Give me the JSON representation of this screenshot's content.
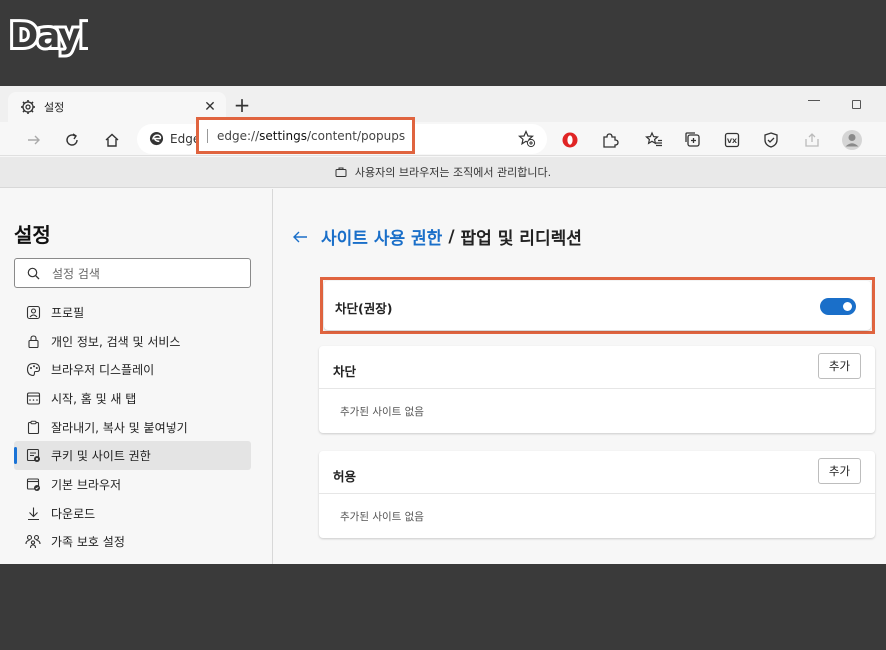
{
  "logo": {
    "text": "DayB"
  },
  "tab": {
    "title": "설정",
    "close": "✕",
    "new_tab": "+"
  },
  "address": {
    "site_label": "Edge",
    "url_prefix": "edge://",
    "url_highlight": "settings",
    "url_suffix": "/content/popups"
  },
  "managed_notice": "사용자의 브라우저는 조직에서 관리합니다.",
  "sidebar": {
    "title": "설정",
    "search_placeholder": "설정 검색",
    "items": [
      {
        "label": "프로필",
        "icon": "profile-icon"
      },
      {
        "label": "개인 정보, 검색 및 서비스",
        "icon": "lock-icon"
      },
      {
        "label": "브라우저 디스플레이",
        "icon": "palette-icon"
      },
      {
        "label": "시작, 홈 및 새 탭",
        "icon": "power-icon"
      },
      {
        "label": "잘라내기, 복사 및 붙여넣기",
        "icon": "clipboard-icon"
      },
      {
        "label": "쿠키 및 사이트 권한",
        "icon": "site-permissions-icon",
        "active": true
      },
      {
        "label": "기본 브라우저",
        "icon": "browser-icon"
      },
      {
        "label": "다운로드",
        "icon": "download-icon"
      },
      {
        "label": "가족 보호 설정",
        "icon": "family-icon"
      }
    ]
  },
  "main": {
    "breadcrumb_link": "사이트 사용 권한",
    "breadcrumb_sep": "/",
    "breadcrumb_current": "팝업 및 리디렉션",
    "toggle": {
      "label": "차단(권장)",
      "enabled": true
    },
    "block": {
      "title": "차단",
      "add_label": "추가",
      "empty_text": "추가된 사이트 없음"
    },
    "allow": {
      "title": "허용",
      "add_label": "추가",
      "empty_text": "추가된 사이트 없음"
    }
  },
  "colors": {
    "accent": "#1a6fc9",
    "highlight_box": "#e0643f",
    "outer_bg": "#3a3a3a"
  }
}
